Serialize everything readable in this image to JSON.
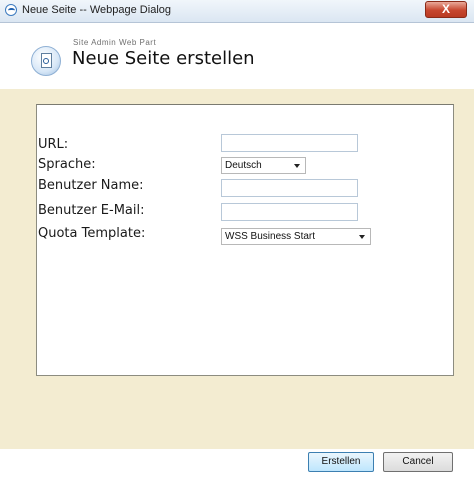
{
  "window": {
    "title": "Neue Seite -- Webpage Dialog",
    "close_label": "X"
  },
  "header": {
    "subtitle": "Site Admin Web Part",
    "title": "Neue Seite erstellen"
  },
  "form": {
    "fields": [
      {
        "label": "URL:",
        "value": ""
      },
      {
        "label": "Sprache:",
        "selected": "Deutsch"
      },
      {
        "label": "Benutzer Name:",
        "value": ""
      },
      {
        "label": "Benutzer E-Mail:",
        "value": ""
      },
      {
        "label": "Quota Template:",
        "selected": "WSS Business Start"
      }
    ]
  },
  "buttons": {
    "create": "Erstellen",
    "cancel": "Cancel"
  }
}
